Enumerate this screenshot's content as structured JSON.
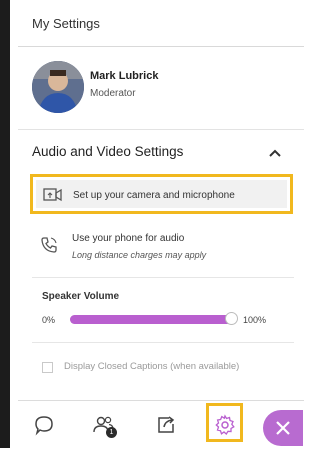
{
  "header": {
    "title": "My Settings"
  },
  "profile": {
    "name": "Mark Lubrick",
    "role": "Moderator"
  },
  "audio_video": {
    "section_title": "Audio and Video Settings",
    "camera_button_label": "Set up your camera and microphone",
    "phone_title": "Use your phone for audio",
    "phone_subtitle": "Long distance charges may apply"
  },
  "speaker": {
    "title": "Speaker Volume",
    "min_label": "0%",
    "max_label": "100%",
    "level_percent": 100
  },
  "captions": {
    "label": "Display Closed Captions (when available)",
    "checked": false
  },
  "footer": {
    "participants_badge": "1"
  },
  "colors": {
    "highlight": "#f1b81e",
    "accent": "#b95fcf",
    "close_button": "#b86bd0",
    "left_bar": "#1c1c1c"
  },
  "icons": [
    "chat-icon",
    "participants-icon",
    "share-content-icon",
    "settings-gear-icon",
    "close-icon",
    "camera-icon",
    "phone-icon",
    "chevron-up-icon"
  ]
}
